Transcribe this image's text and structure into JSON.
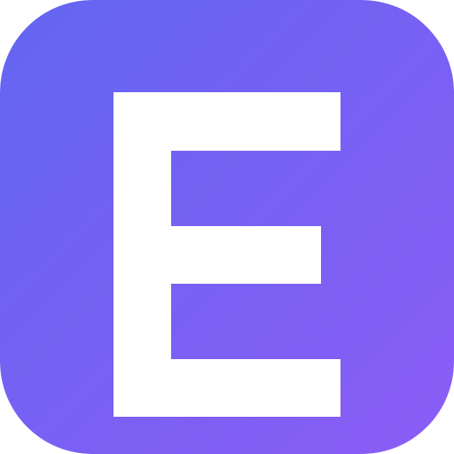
{
  "icon": {
    "name": "app-icon",
    "letter": "E",
    "gradient_start": "#6366F1",
    "gradient_end": "#8B5CF6",
    "letter_color": "#FFFFFF"
  }
}
